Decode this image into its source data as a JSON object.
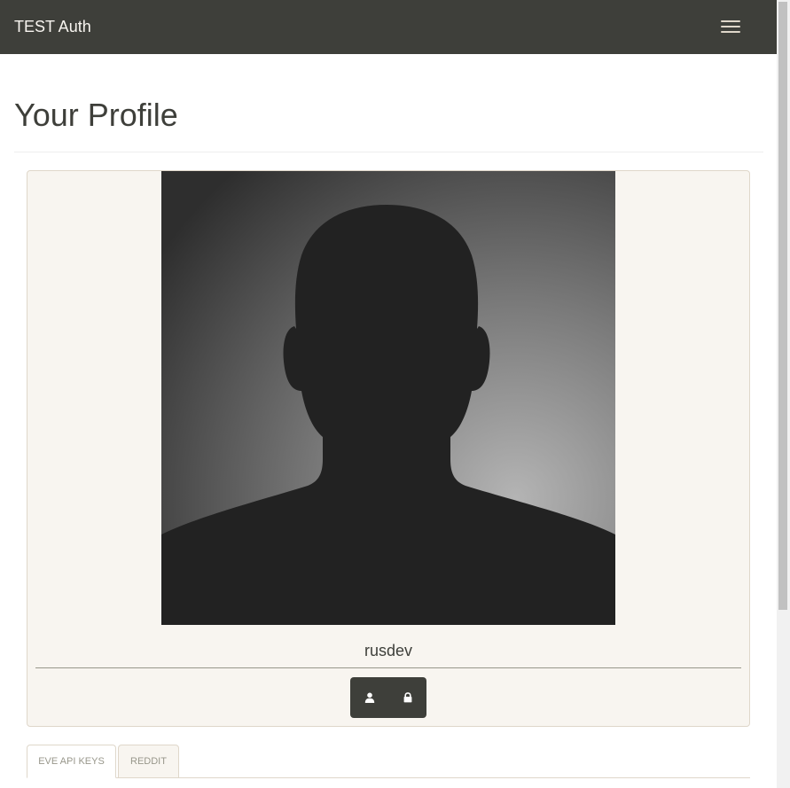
{
  "navbar": {
    "brand": "TEST Auth"
  },
  "page": {
    "title": "Your Profile"
  },
  "profile": {
    "username": "rusdev",
    "actions": [
      {
        "icon": "user-icon"
      },
      {
        "icon": "lock-icon"
      }
    ]
  },
  "tabs": [
    {
      "label": "EVE API Keys",
      "active": true
    },
    {
      "label": "Reddit",
      "active": false
    }
  ],
  "colors": {
    "navbar": "#3e3f3a",
    "panel": "#f8f5f0",
    "border": "#dfd7ca",
    "muted": "#98978b"
  }
}
